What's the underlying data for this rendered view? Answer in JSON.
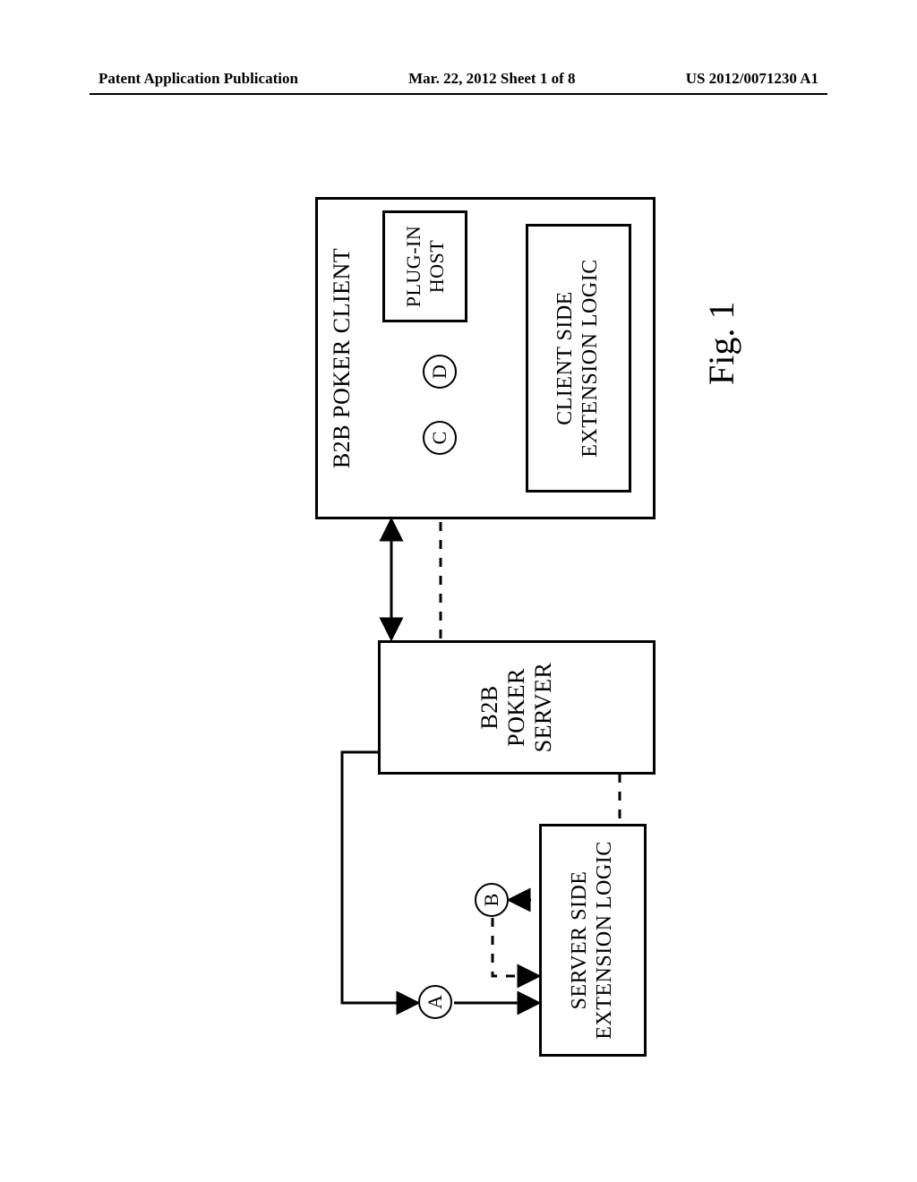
{
  "header": {
    "left": "Patent Application Publication",
    "center": "Mar. 22, 2012  Sheet 1 of 8",
    "right": "US 2012/0071230 A1"
  },
  "figure": {
    "caption": "Fig. 1",
    "server_ext": "SERVER SIDE\nEXTENSION LOGIC",
    "server": "B2B POKER SERVER",
    "client_title": "B2B POKER CLIENT",
    "plugin": "PLUG-IN\nHOST",
    "client_ext": "CLIENT SIDE\nEXTENSION LOGIC",
    "labels": {
      "A": "A",
      "B": "B",
      "C": "C",
      "D": "D"
    }
  }
}
